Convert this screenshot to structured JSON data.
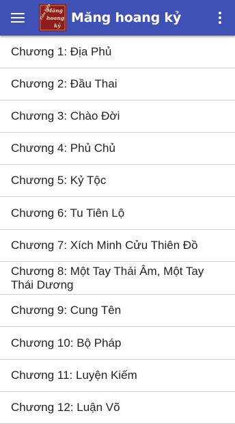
{
  "app_bar": {
    "title": "Măng hoang kỷ",
    "background_color": "#3f51b5",
    "title_color": "#ffffff",
    "menu_icon": "hamburger-menu-icon",
    "overflow_icon": "more-vert-icon",
    "logo_text": [
      "Tiên hiệp",
      "Măng",
      "hoang",
      "kỷ"
    ]
  },
  "chapters": [
    {
      "label": "Chương 1: Địa Phủ"
    },
    {
      "label": "Chương 2: Đầu Thai"
    },
    {
      "label": "Chương 3: Chào Đời"
    },
    {
      "label": "Chương 4: Phủ Chủ"
    },
    {
      "label": "Chương 5: Kỷ Tộc"
    },
    {
      "label": "Chương 6: Tu Tiên Lộ"
    },
    {
      "label": "Chương 7: Xích Minh Cửu Thiên Đồ"
    },
    {
      "label": "Chương 8: Một Tay Thái Âm, Một Tay Thái Dương"
    },
    {
      "label": "Chương 9: Cung Tên"
    },
    {
      "label": "Chương 10: Bộ Pháp"
    },
    {
      "label": "Chương 11: Luyện Kiếm"
    },
    {
      "label": "Chương 12: Luận Võ"
    }
  ]
}
